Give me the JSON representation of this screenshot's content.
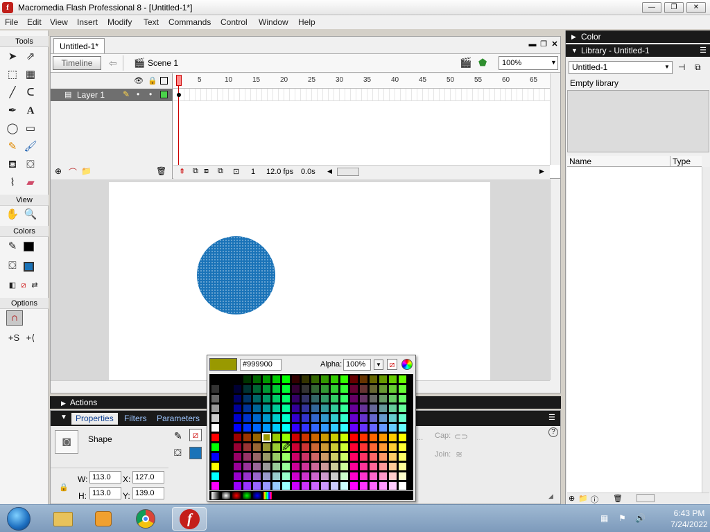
{
  "window": {
    "title": "Macromedia Flash Professional 8 - [Untitled-1*]",
    "app_icon": "f",
    "controls": [
      "—",
      "❐",
      "✕"
    ]
  },
  "menu": [
    "File",
    "Edit",
    "View",
    "Insert",
    "Modify",
    "Text",
    "Commands",
    "Control",
    "Window",
    "Help"
  ],
  "tools": {
    "header": "Tools",
    "view_label": "View",
    "colors_label": "Colors",
    "options_label": "Options"
  },
  "document": {
    "tab": "Untitled-1*",
    "timeline_button": "Timeline",
    "scene": "Scene 1",
    "zoom": "100%"
  },
  "timeline": {
    "layer_name": "Layer 1",
    "ruler_ticks": [
      "1",
      "5",
      "10",
      "15",
      "20",
      "25",
      "30",
      "35",
      "40",
      "45",
      "50",
      "55",
      "60",
      "65"
    ],
    "current_frame": "1",
    "fps": "12.0 fps",
    "elapsed": "0.0s"
  },
  "panels": {
    "actions": "Actions",
    "properties_tab": "Properties",
    "filters_tab": "Filters",
    "parameters_tab": "Parameters"
  },
  "properties": {
    "object_type": "Shape",
    "w_label": "W:",
    "w": "113.0",
    "h_label": "H:",
    "h": "113.0",
    "x_label": "X:",
    "x": "127.0",
    "y_label": "Y:",
    "y": "139.0",
    "cap_label": "Cap:",
    "join_label": "Join:",
    "ellipsis": "..."
  },
  "color_picker": {
    "hex": "#999900",
    "alpha_label": "Alpha:",
    "alpha": "100%",
    "selected_color": "#999900"
  },
  "right": {
    "color_panel": "Color",
    "library_panel": "Library - Untitled-1",
    "library_select": "Untitled-1",
    "empty": "Empty library",
    "col_name": "Name",
    "col_type": "Type"
  },
  "colors": {
    "stroke": "#000000",
    "fill": "#1a73b8",
    "circle": "#1a73b8"
  },
  "taskbar": {
    "time": "6:43 PM",
    "date": "7/24/2022",
    "apps": [
      "start-orb",
      "file-explorer",
      "media-player",
      "chrome",
      "flash"
    ]
  }
}
